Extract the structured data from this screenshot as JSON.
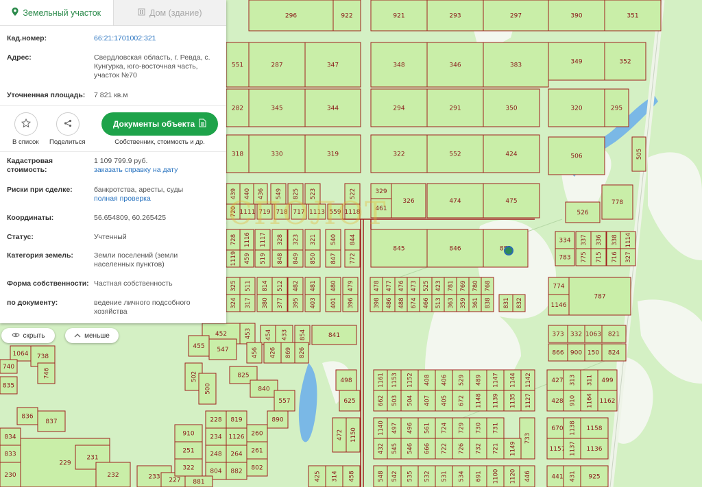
{
  "tabs": [
    {
      "label": "Земельный участок",
      "icon": "map-pin-icon"
    },
    {
      "label": "Дом (здание)",
      "icon": "building-icon"
    }
  ],
  "info": {
    "cad_num_key": "Кад.номер:",
    "cad_num_val": "66:21:1701002:321",
    "address_key": "Адрес:",
    "address_val": "Свердловская область, г. Ревда, с. Кунгурка, юго-восточная часть, участок №70",
    "area_key": "Уточненная площадь:",
    "area_val": "7 821 кв.м",
    "cost_key": "Кадастровая стоимость:",
    "cost_val": "1 109 799.9 руб.",
    "cost_link": "заказать справку на дату",
    "risk_key": "Риски при сделке:",
    "risk_val": "банкротства, аресты, суды",
    "risk_link": "полная проверка",
    "coord_key": "Координаты:",
    "coord_val": "56.654809, 60.265425",
    "status_key": "Статус:",
    "status_val": "Учтенный",
    "cat_key": "Категория земель:",
    "cat_val": "Земли поселений (земли населенных пунктов)",
    "own_key": "Форма собственности:",
    "own_val": "Частная собственность",
    "doc_key": "по документу:",
    "doc_val": "ведение личного подсобного хозяйства"
  },
  "actions": {
    "list_label": "В список",
    "list_icon": "star-icon",
    "share_label": "Поделиться",
    "share_icon": "share-icon",
    "docs_button": "Документы объекта",
    "docs_icon": "document-icon",
    "docs_sub": "Собственник, стоимость и др."
  },
  "pills": {
    "hide": "скрыть",
    "hide_icon": "eye-icon",
    "less": "меньше",
    "less_icon": "chevron-up-icon"
  },
  "watermark": "ЭКСПОЛОТ",
  "colors": {
    "parcel_fill": "#c9eea8",
    "parcel_stroke": "#a0201e",
    "forest": "#f3f7ef",
    "water": "#7ab8e6",
    "accent": "#1ea34a"
  },
  "map_labels": [
    "296",
    "922",
    "921",
    "293",
    "297",
    "390",
    "351",
    "551",
    "287",
    "347",
    "348",
    "346",
    "383",
    "349",
    "352",
    "282",
    "345",
    "344",
    "294",
    "291",
    "350",
    "320",
    "295",
    "318",
    "330",
    "319",
    "322",
    "552",
    "424",
    "506",
    "505",
    "439",
    "440",
    "436",
    "549",
    "825",
    "523",
    "522",
    "329",
    "326",
    "474",
    "475",
    "526",
    "778",
    "461",
    "1118",
    "559",
    "1113",
    "717",
    "718",
    "719",
    "1111",
    "720",
    "728",
    "1116",
    "1117",
    "328",
    "323",
    "321",
    "540",
    "844",
    "845",
    "846",
    "851",
    "334",
    "337",
    "336",
    "338",
    "1114",
    "1119",
    "459",
    "519",
    "848",
    "849",
    "850",
    "847",
    "772",
    "783",
    "775",
    "715",
    "716",
    "327",
    "325",
    "511",
    "814",
    "512",
    "482",
    "481",
    "480",
    "479",
    "478",
    "477",
    "476",
    "473",
    "525",
    "423",
    "781",
    "769",
    "780",
    "768",
    "774",
    "787",
    "324",
    "317",
    "380",
    "377",
    "395",
    "403",
    "401",
    "396",
    "398",
    "486",
    "488",
    "674",
    "466",
    "513",
    "363",
    "359",
    "361",
    "838",
    "831",
    "832",
    "1146",
    "452",
    "453",
    "454",
    "433",
    "854",
    "841",
    "373",
    "332",
    "1063",
    "821",
    "455",
    "547",
    "456",
    "426",
    "869",
    "826",
    "866",
    "900",
    "150",
    "824",
    "825",
    "840",
    "502",
    "500",
    "557",
    "1161",
    "1153",
    "1152",
    "408",
    "406",
    "529",
    "489",
    "1147",
    "1144",
    "1142",
    "427",
    "313",
    "311",
    "499",
    "498",
    "625",
    "662",
    "503",
    "504",
    "407",
    "405",
    "672",
    "1148",
    "1139",
    "1135",
    "1127",
    "428",
    "910",
    "1164",
    "1162",
    "472",
    "1150",
    "1140",
    "497",
    "496",
    "561",
    "724",
    "729",
    "730",
    "731",
    "733",
    "670",
    "1138",
    "1158",
    "432",
    "545",
    "546",
    "666",
    "722",
    "726",
    "732",
    "721",
    "1149",
    "1157",
    "1137",
    "1136",
    "425",
    "314",
    "458",
    "548",
    "542",
    "535",
    "532",
    "531",
    "534",
    "691",
    "1100",
    "1120",
    "446",
    "441",
    "431",
    "925",
    "1064",
    "740",
    "738",
    "746",
    "835",
    "836",
    "837",
    "834",
    "833",
    "230",
    "229",
    "231",
    "232",
    "233",
    "227",
    "228",
    "819",
    "234",
    "1126",
    "248",
    "264",
    "804",
    "882",
    "260",
    "261",
    "802",
    "890",
    "910",
    "251",
    "322",
    "881"
  ]
}
